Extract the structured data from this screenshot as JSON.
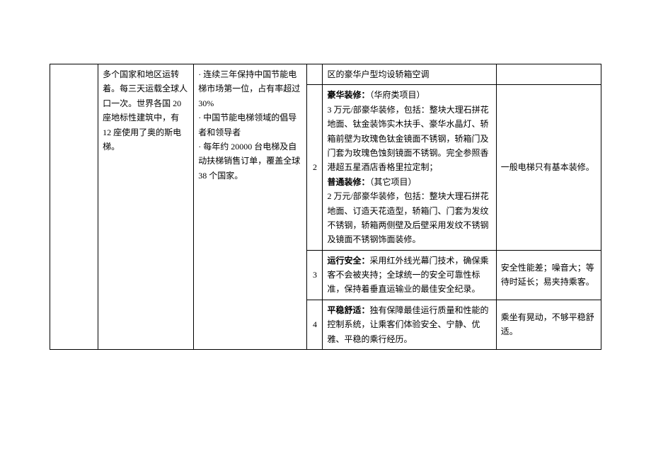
{
  "col_b_r1": "多个国家和地区运转着。每三天运载全球人口一次。世界各国 20 座地标性建筑中，有 12 座使用了奥的斯电梯。",
  "col_c_r1": "· 连续三年保持中国节能电梯市场第一位，占有率超过 30%\n· 中国节能电梯领域的倡导者和领导者\n· 每年约 20000 台电梯及自动扶梯销售订单，覆盖全球 38 个国家。",
  "r1_e": "区的豪华户型均设轿箱空调",
  "r2_d": "2",
  "r2_e_lux_title": "豪华装修：",
  "r2_e_lux_proj": "（华府类项目）",
  "r2_e_lux_body": "3 万元/部豪华装修，包括：整块大理石拼花地面、钛金装饰实木扶手、豪华水晶灯、轿箱前壁为玫瑰色钛金镜面不锈钢，轿箱门及门套为玫瑰色蚀刻镜面不锈钢。完全参照香港超五星酒店香格里拉定制；",
  "r2_e_std_title": "普通装修：",
  "r2_e_std_proj": "（其它项目）",
  "r2_e_std_body": "2 万元/部豪华装修，包括：整块大理石拼花地面、订造天花造型，轿箱门、门套为发纹不锈钢，轿箱两侧壁及后壁采用发纹不锈钢及镜面不锈钢饰面装修。",
  "r2_f": "一般电梯只有基本装修。",
  "r3_d": "3",
  "r3_e_title": "运行安全：",
  "r3_e_body": "采用红外线光幕门技术，确保乘客不会被夹持；全球统一的安全可靠性标准，保持着垂直运输业的最佳安全纪录。",
  "r3_f": "安全性能差；噪音大；等待时延长；易夹持乘客。",
  "r4_d": "4",
  "r4_e_title": "平稳舒适：",
  "r4_e_body": "独有保障最佳运行质量和性能的控制系统，让乘客们体验安全、宁静、优雅、平稳的乘行经历。",
  "r4_f": "乘坐有晃动，不够平稳舒适。"
}
